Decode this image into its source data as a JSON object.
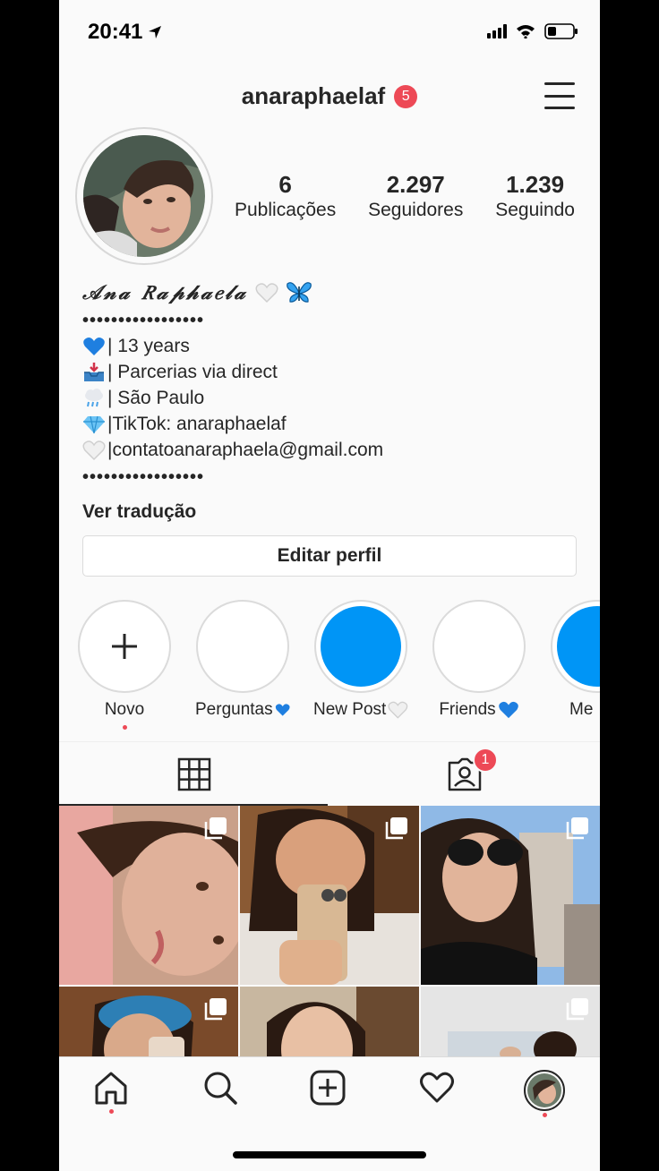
{
  "status_bar": {
    "time": "20:41"
  },
  "header": {
    "username": "anaraphaelaf",
    "notification_count": "5"
  },
  "profile": {
    "stats": [
      {
        "value": "6",
        "label": "Publicações"
      },
      {
        "value": "2.297",
        "label": "Seguidores"
      },
      {
        "value": "1.239",
        "label": "Seguindo"
      }
    ],
    "bio": {
      "name": "𝒜𝓃𝒶 𝑅𝒶𝓅𝒽𝒶𝑒𝓁𝒶",
      "dots": "•••••••••••••••••",
      "lines": [
        {
          "emoji": "blue-heart",
          "text": "| 13 years"
        },
        {
          "emoji": "inbox-tray",
          "text": "| Parcerias via direct"
        },
        {
          "emoji": "cloud-rain",
          "text": "| São Paulo"
        },
        {
          "emoji": "gem",
          "text": "|TikTok: anaraphaelaf"
        },
        {
          "emoji": "white-heart",
          "text": "|contatoanaraphaela@gmail.com"
        }
      ],
      "translate": "Ver tradução"
    },
    "edit_button": "Editar perfil"
  },
  "highlights": [
    {
      "label": "Novo",
      "emoji": ""
    },
    {
      "label": "Perguntas",
      "emoji": "blue-heart"
    },
    {
      "label": "New Post",
      "emoji": "white-heart"
    },
    {
      "label": "Friends",
      "emoji": "blue-heart"
    },
    {
      "label": "Me",
      "emoji": ""
    }
  ],
  "tabs": {
    "tagged_count": "1"
  },
  "colors": {
    "accent_blue": "#0095f6",
    "badge_red": "#ed4956",
    "text": "#262626"
  }
}
